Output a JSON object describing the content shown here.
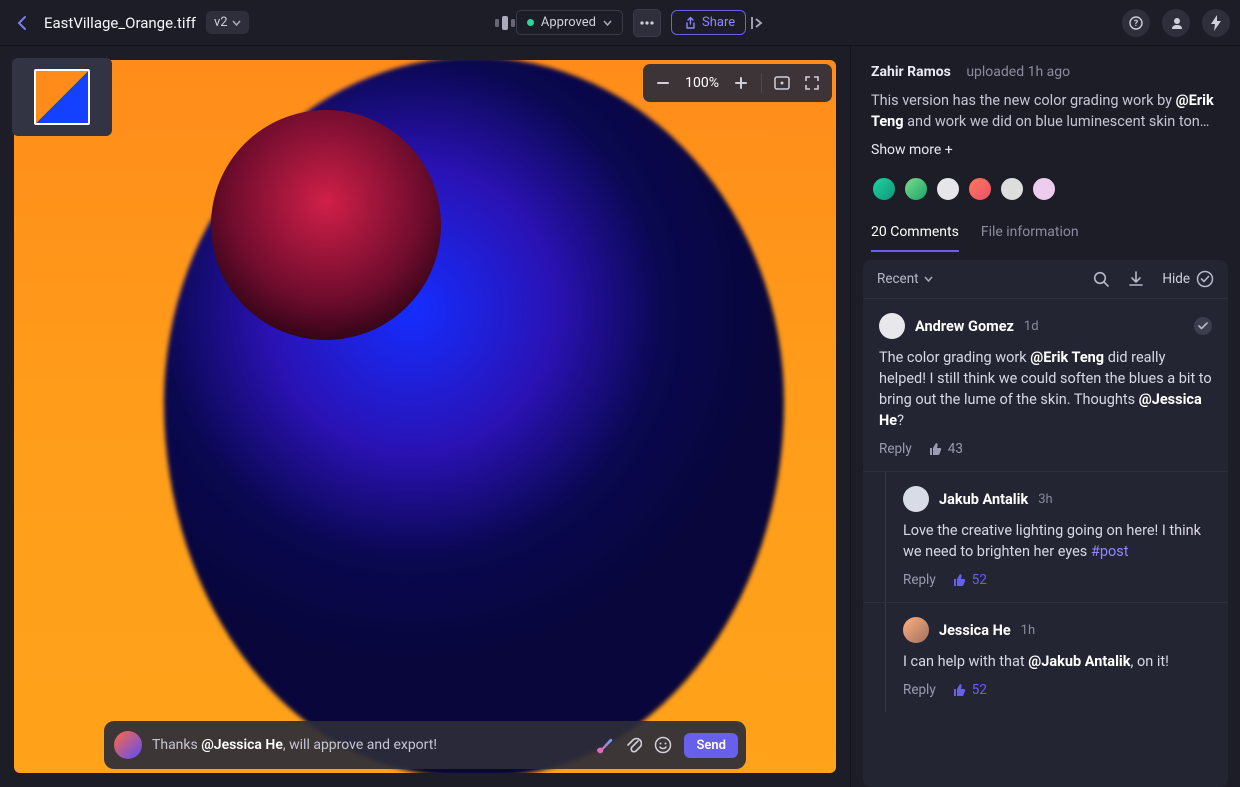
{
  "header": {
    "filename": "EastVillage_Orange.tiff",
    "version": "v2",
    "status": "Approved",
    "share_label": "Share"
  },
  "zoom": {
    "value": "100%"
  },
  "composer": {
    "prefix": "Thanks ",
    "mention": "@Jessica He",
    "suffix": ", will approve and export!",
    "send_label": "Send"
  },
  "sidepanel": {
    "uploader_name": "Zahir Ramos",
    "uploader_action": "uploaded",
    "uploader_time": "1h ago",
    "description_line1": "This version has the new color grading work by ",
    "description_mention": "@Erik Teng",
    "description_line2": " and work we did on blue luminescent skin ton…",
    "showmore": "Show more +",
    "tab_comments": "20 Comments",
    "tab_fileinfo": "File information",
    "filter": {
      "sort": "Recent",
      "hide": "Hide"
    }
  },
  "comments": [
    {
      "author": "Andrew Gomez",
      "time": "1d",
      "body_pre": "The color grading work ",
      "mention1": "@Erik Teng",
      "body_mid": " did really helped! I still think we could soften the blues a bit to bring out the lume of the skin. Thoughts ",
      "mention2": "@Jessica He",
      "body_post": "?",
      "reply_label": "Reply",
      "likes": "43"
    },
    {
      "author": "Jakub Antalik",
      "time": "3h",
      "body_pre": "Love the creative lighting going on here! I think we need to brighten her eyes ",
      "tag": "#post",
      "reply_label": "Reply",
      "likes": "52"
    },
    {
      "author": "Jessica He",
      "time": "1h",
      "body_pre": "I can help with that ",
      "mention1": "@Jakub Antalik",
      "body_post": ", on it!",
      "reply_label": "Reply",
      "likes": "52"
    }
  ]
}
